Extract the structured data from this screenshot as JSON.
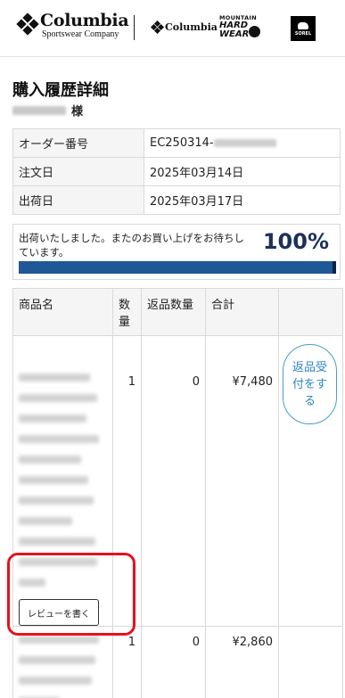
{
  "header": {
    "brand_main": "Columbia",
    "brand_sub": "Sportswear Company",
    "brand_small": "Columbia",
    "mhw_top": "MOUNTAIN",
    "mhw_line1": "HARD",
    "mhw_line2": "WEAR",
    "sorel": "SOREL"
  },
  "page": {
    "title": "購入履歴詳細",
    "customer_suffix": "様"
  },
  "order_info": {
    "rows": [
      {
        "label": "オーダー番号",
        "value": "EC250314-"
      },
      {
        "label": "注文日",
        "value": "2025年03月14日"
      },
      {
        "label": "出荷日",
        "value": "2025年03月17日"
      }
    ]
  },
  "status": {
    "message": "出荷いたしました。またのお買い上げをお待ちしています。",
    "percent_label": "100%",
    "progress": 1.0,
    "bar_color": "#1f5797"
  },
  "items_table": {
    "headers": {
      "name": "商品名",
      "qty": "数量",
      "return_qty": "返品数量",
      "total": "合計",
      "action": ""
    },
    "rows": [
      {
        "qty": "1",
        "return_qty": "0",
        "total": "¥7,480",
        "review_label": "レビューを書く",
        "return_label": "返品受付をする"
      },
      {
        "qty": "1",
        "return_qty": "0",
        "total": "¥2,860"
      }
    ]
  },
  "colors": {
    "accent_navy": "#1b3158",
    "return_button": "#2e86c1",
    "highlight": "#e5121d"
  }
}
